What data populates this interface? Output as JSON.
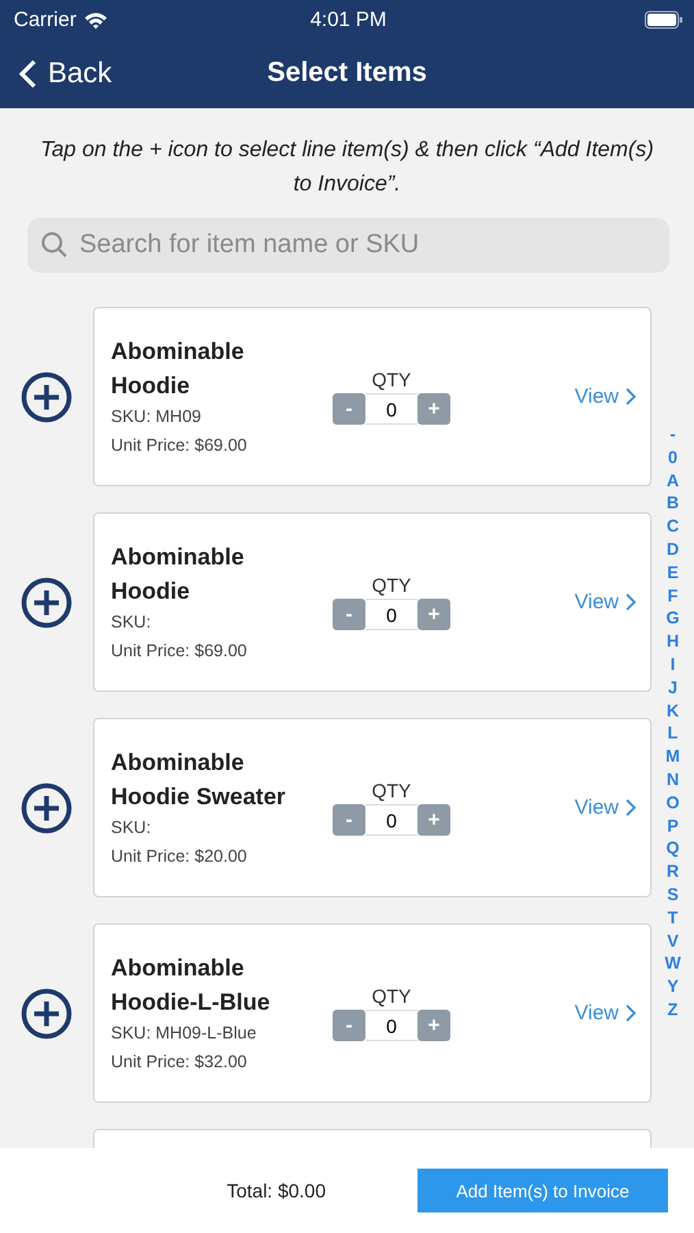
{
  "status_bar": {
    "carrier": "Carrier",
    "time": "4:01 PM"
  },
  "nav": {
    "back": "Back",
    "title": "Select Items"
  },
  "instruction": "Tap on the + icon to select line item(s) & then click “Add Item(s) to Invoice”.",
  "search": {
    "placeholder": "Search for item name or SKU"
  },
  "items": [
    {
      "kind": "item",
      "name": "Abominable Hoodie",
      "sku": "SKU: MH09",
      "price": "Unit Price: $69.00",
      "qty_label": "QTY",
      "minus": "-",
      "qty": "0",
      "plus": "+",
      "view": "View"
    },
    {
      "kind": "item",
      "name": "Abominable Hoodie",
      "sku": "SKU:",
      "price": "Unit Price: $69.00",
      "qty_label": "QTY",
      "minus": "-",
      "qty": "0",
      "plus": "+",
      "view": "View"
    },
    {
      "kind": "item",
      "name": "Abominable Hoodie Sweater",
      "sku": "SKU:",
      "price": "Unit Price: $20.00",
      "qty_label": "QTY",
      "minus": "-",
      "qty": "0",
      "plus": "+",
      "view": "View"
    },
    {
      "kind": "item",
      "name": "Abominable Hoodie-L-Blue",
      "sku": "SKU: MH09-L-Blue",
      "price": "Unit Price: $32.00",
      "qty_label": "QTY",
      "minus": "-",
      "qty": "0",
      "plus": "+",
      "view": "View"
    },
    {
      "kind": "cut"
    }
  ],
  "index": [
    "-",
    "0",
    "A",
    "B",
    "C",
    "D",
    "E",
    "F",
    "G",
    "H",
    "I",
    "J",
    "K",
    "L",
    "M",
    "N",
    "O",
    "P",
    "Q",
    "R",
    "S",
    "T",
    "V",
    "W",
    "Y",
    "Z"
  ],
  "footer": {
    "total": "Total: $0.00",
    "button": "Add Item(s) to Invoice"
  }
}
